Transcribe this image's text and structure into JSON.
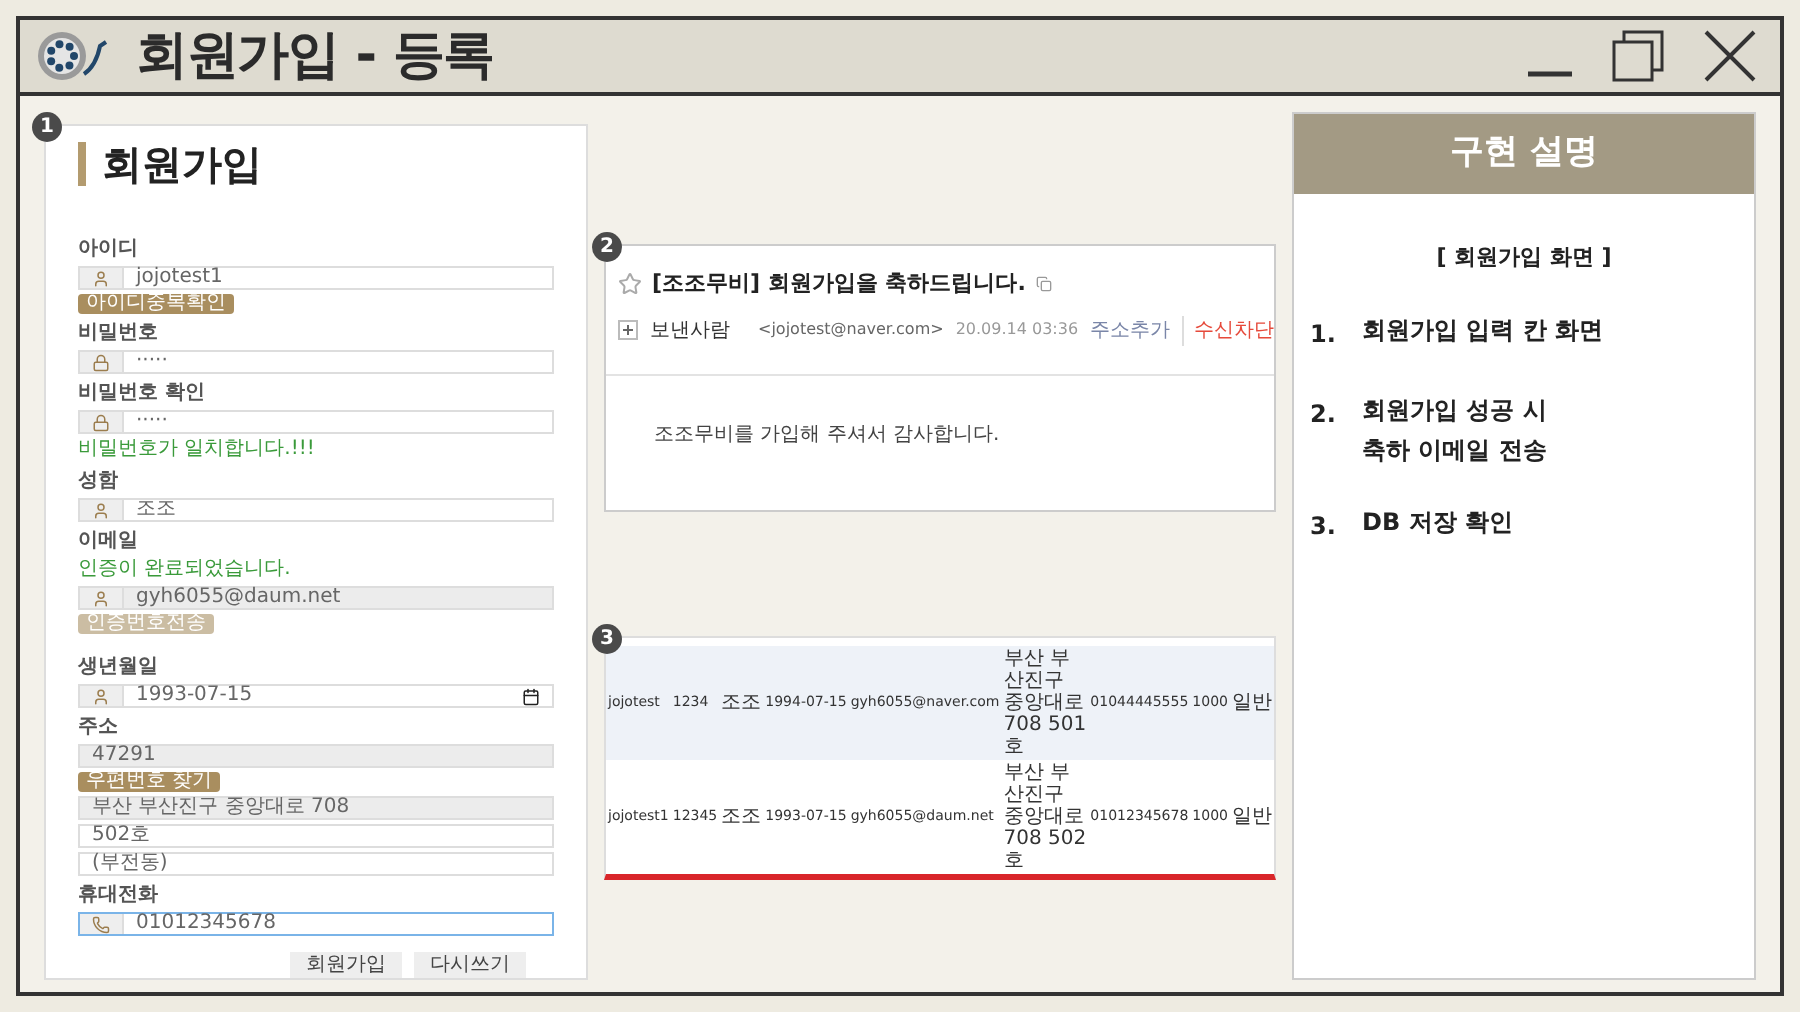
{
  "window": {
    "title": "회원가입 - 등록"
  },
  "signup_form": {
    "marker": "1",
    "title": "회원가입",
    "rows": [
      {
        "kind": "label",
        "text": "아이디"
      },
      {
        "kind": "person_field",
        "value": "jojotest1",
        "disabled": false,
        "focused": false
      },
      {
        "kind": "button",
        "text": "아이디중복확인",
        "disabled": false
      },
      {
        "kind": "label",
        "text": "비밀번호"
      },
      {
        "kind": "lock_field",
        "value": "·····",
        "disabled": false,
        "focused": false
      },
      {
        "kind": "label",
        "text": "비밀번호 확인"
      },
      {
        "kind": "lock_field",
        "value": "·····",
        "disabled": false,
        "focused": false
      },
      {
        "kind": "message",
        "text": "비밀번호가 일치합니다.!!!"
      },
      {
        "kind": "label",
        "text": "성함"
      },
      {
        "kind": "person_field",
        "value": "조조",
        "disabled": false,
        "focused": false
      },
      {
        "kind": "label",
        "text": "이메일"
      },
      {
        "kind": "message",
        "text": "인증이 완료되었습니다."
      },
      {
        "kind": "person_field",
        "value": "gyh6055@daum.net",
        "disabled": true,
        "focused": false
      },
      {
        "kind": "button",
        "text": "인증번호전송",
        "disabled": true
      },
      {
        "kind": "spacer"
      },
      {
        "kind": "label",
        "text": "생년월일"
      },
      {
        "kind": "date_field",
        "value": "1993-07-15",
        "disabled": false,
        "focused": false
      },
      {
        "kind": "label",
        "text": "주소"
      },
      {
        "kind": "plain_field",
        "value": "47291",
        "disabled": true,
        "focused": false
      },
      {
        "kind": "button",
        "text": "우편번호 찾기",
        "disabled": false
      },
      {
        "kind": "plain_field",
        "value": "부산 부산진구 중앙대로 708",
        "disabled": true,
        "focused": false
      },
      {
        "kind": "plain_field",
        "value": "502호",
        "disabled": false,
        "focused": false
      },
      {
        "kind": "plain_field",
        "value": "(부전동)",
        "disabled": false,
        "focused": false
      },
      {
        "kind": "label",
        "text": "휴대전화"
      },
      {
        "kind": "phone_field",
        "value": "01012345678",
        "disabled": false,
        "focused": true
      }
    ],
    "actions": [
      "회원가입",
      "다시쓰기"
    ]
  },
  "email": {
    "marker": "2",
    "subject": "[조조무비] 회원가입을 축하드립니다.",
    "sender_label": "보낸사람",
    "address": "<jojotest@naver.com>",
    "date": "20.09.14 03:36",
    "actions": [
      {
        "text": "주소추가",
        "kind": "add"
      },
      {
        "text": "수신차단",
        "kind": "block"
      }
    ],
    "body": "조조무비를 가입해 주셔서 감사합니다."
  },
  "db_table": {
    "marker": "3",
    "rows": [
      [
        "jojotest",
        "1234",
        "조조",
        "1994-07-15",
        "gyh6055@naver.com",
        "부산 부산진구 중앙대로 708 501호",
        "01044445555",
        "1000",
        "일반"
      ],
      [
        "jojotest1",
        "12345",
        "조조",
        "1993-07-15",
        "gyh6055@daum.net",
        "부산 부산진구 중앙대로 708 502호",
        "01012345678",
        "1000",
        "일반"
      ]
    ]
  },
  "explanation": {
    "title": "구현 설명",
    "subtitle": "[ 회원가입 화면 ]",
    "items": [
      {
        "number": "1.",
        "lines": [
          "회원가입 입력 칸 화면"
        ]
      },
      {
        "number": "2.",
        "lines": [
          "회원가입 성공 시",
          "축하 이메일 전송"
        ]
      },
      {
        "number": "3.",
        "lines": [
          "DB 저장 확인"
        ]
      }
    ]
  }
}
